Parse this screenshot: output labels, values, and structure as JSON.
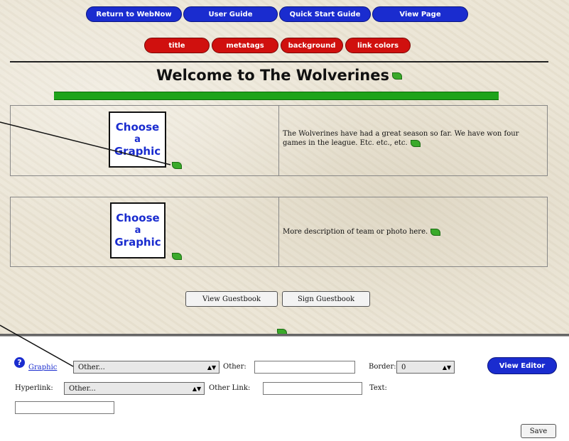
{
  "nav": {
    "blue_buttons": [
      "Return to WebNow",
      "User Guide",
      "Quick Start Guide",
      "View Page"
    ],
    "red_buttons": [
      "title",
      "metatags",
      "background",
      "link colors"
    ]
  },
  "page": {
    "title": "Welcome to The Wolverines",
    "rows": [
      {
        "graphic_label": "Choose a Graphic",
        "description": "The Wolverines have had a great season so far. We have won four games in the league. Etc. etc., etc."
      },
      {
        "graphic_label": "Choose a Graphic",
        "description": "More description of team or photo here."
      }
    ],
    "graphic_lines": [
      "Choose",
      "a",
      "Graphic"
    ],
    "guestbook": {
      "view_label": "View Guestbook",
      "sign_label": "Sign Guestbook"
    }
  },
  "editor": {
    "graphic_link": "Graphic",
    "graphic_select": "Other...",
    "other_label": "Other:",
    "other_value": "",
    "border_label": "Border:",
    "border_value": "0",
    "view_editor_label": "View Editor",
    "hyperlink_label": "Hyperlink:",
    "hyperlink_select": "Other...",
    "other_link_label": "Other Link:",
    "other_link_value": "",
    "text_label": "Text:",
    "text_value": "",
    "save_label": "Save"
  },
  "colors": {
    "blue": "#1a2ccf",
    "red": "#d0100e",
    "green": "#1ea31a"
  }
}
